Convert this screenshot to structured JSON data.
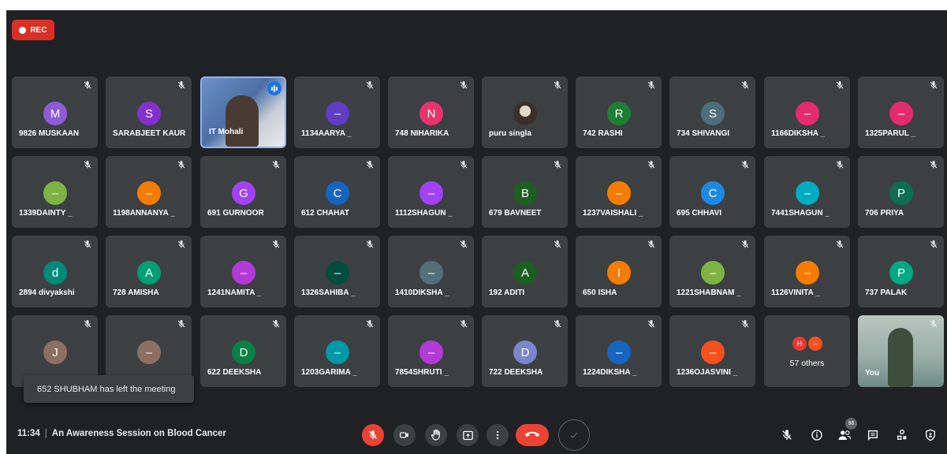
{
  "recording": {
    "label": "REC",
    "color": "#d93025"
  },
  "participants": [
    {
      "name": "9826 MUSKAAN",
      "initial": "M",
      "color": "#8e5cd9"
    },
    {
      "name": "SARABJEET KAUR",
      "initial": "S",
      "color": "#8430ce"
    },
    {
      "name": "IT Mohali",
      "initial": "",
      "color": "#5a7fb5",
      "video": true,
      "speaking": true
    },
    {
      "name": "1134AARYA _",
      "initial": "–",
      "color": "#5f3dc4"
    },
    {
      "name": "748 NIHARIKA",
      "initial": "N",
      "color": "#e8336b"
    },
    {
      "name": "puru singla",
      "initial": "",
      "color": "#8a7a6a",
      "photo": true
    },
    {
      "name": "742 RASHI",
      "initial": "R",
      "color": "#1e7e34"
    },
    {
      "name": "734 SHIVANGI",
      "initial": "S",
      "color": "#4f6d7a"
    },
    {
      "name": "1166DIKSHA _",
      "initial": "–",
      "color": "#e52b6c"
    },
    {
      "name": "1325PARUL _",
      "initial": "–",
      "color": "#e52b6c"
    },
    {
      "name": "1339DAINTY _",
      "initial": "–",
      "color": "#7cb342"
    },
    {
      "name": "1198ANNANYA _",
      "initial": "–",
      "color": "#f57c00"
    },
    {
      "name": "691 GURNOOR",
      "initial": "G",
      "color": "#a142f4"
    },
    {
      "name": "612 CHAHAT",
      "initial": "C",
      "color": "#1565c0"
    },
    {
      "name": "1112SHAGUN _",
      "initial": "–",
      "color": "#a142f4"
    },
    {
      "name": "679 BAVNEET",
      "initial": "B",
      "color": "#1b5e20"
    },
    {
      "name": "1237VAISHALI _",
      "initial": "–",
      "color": "#f57c00"
    },
    {
      "name": "695 CHHAVI",
      "initial": "C",
      "color": "#1e88e5"
    },
    {
      "name": "7441SHAGUN _",
      "initial": "–",
      "color": "#00acc1"
    },
    {
      "name": "706 PRIYA",
      "initial": "P",
      "color": "#0b6e4f"
    },
    {
      "name": "2894 divyakshi",
      "initial": "d",
      "color": "#00897b"
    },
    {
      "name": "728 AMISHA",
      "initial": "A",
      "color": "#009e73"
    },
    {
      "name": "1241NAMITA _",
      "initial": "–",
      "color": "#b23ad8"
    },
    {
      "name": "1326SAHIBA _",
      "initial": "–",
      "color": "#004d40"
    },
    {
      "name": "1410DIKSHA _",
      "initial": "–",
      "color": "#546e7a"
    },
    {
      "name": "192 ADITI",
      "initial": "A",
      "color": "#1b5e20"
    },
    {
      "name": "650 ISHA",
      "initial": "I",
      "color": "#f57c00"
    },
    {
      "name": "1221SHABNAM _",
      "initial": "–",
      "color": "#7cb342"
    },
    {
      "name": "1126VINITA _",
      "initial": "–",
      "color": "#f57c00"
    },
    {
      "name": "737 PALAK",
      "initial": "P",
      "color": "#00a884"
    },
    {
      "name": "",
      "initial": "J",
      "color": "#8d6e63"
    },
    {
      "name": "",
      "initial": "–",
      "color": "#8d6e63"
    },
    {
      "name": "622 DEEKSHA",
      "initial": "D",
      "color": "#0a8043"
    },
    {
      "name": "1203GARIMA _",
      "initial": "–",
      "color": "#0097a7"
    },
    {
      "name": "7854SHRUTI _",
      "initial": "–",
      "color": "#b23ad8"
    },
    {
      "name": "722 DEEKSHA",
      "initial": "D",
      "color": "#7986cb"
    },
    {
      "name": "1224DIKSHA _",
      "initial": "–",
      "color": "#1565c0"
    },
    {
      "name": "1236OJASVINI _",
      "initial": "–",
      "color": "#f4511e"
    },
    {
      "name": "57 others",
      "initial": "",
      "color": "#3c4043",
      "others": true,
      "others_initials": [
        "H",
        "–"
      ],
      "others_colors": [
        "#e53935",
        "#f4511e"
      ]
    },
    {
      "name": "You",
      "initial": "",
      "color": "#9bb7b0",
      "self": true
    }
  ],
  "toast": {
    "message": "652 SHUBHAM has left the meeting"
  },
  "meeting": {
    "time": "11:34",
    "separator": "|",
    "title": "An Awareness Session on Blood Cancer"
  },
  "people_count": "96",
  "controls": {
    "mic": "mic-off-icon",
    "camera": "camera-icon",
    "hand": "raise-hand-icon",
    "present": "present-icon",
    "more": "more-options-icon",
    "leave": "leave-call-icon"
  }
}
